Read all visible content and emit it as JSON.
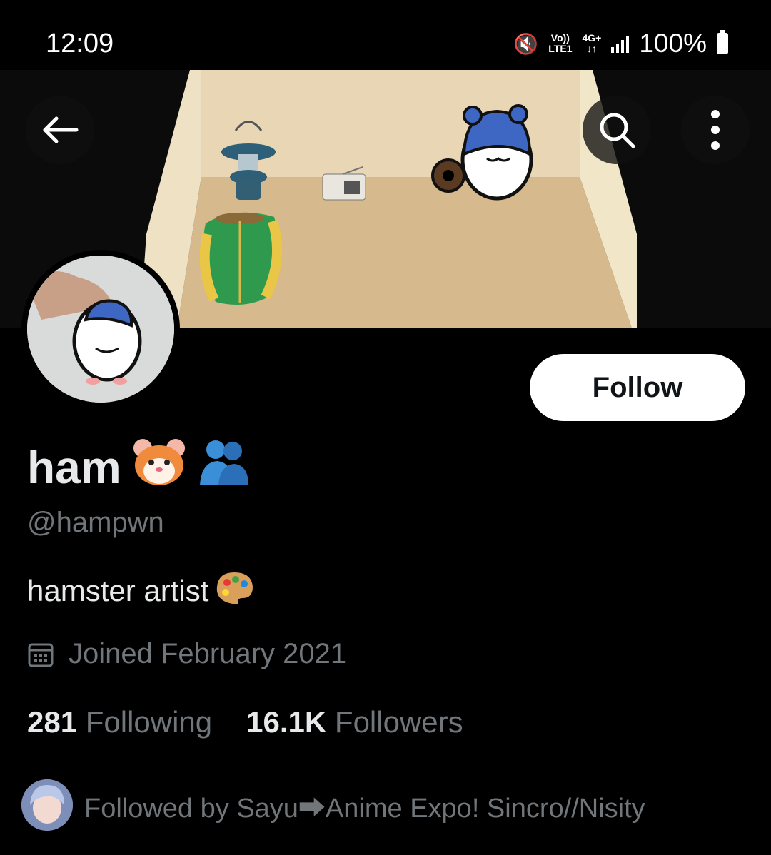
{
  "status_bar": {
    "time": "12:09",
    "volte_line1": "Vo))",
    "volte_line2": "LTE1",
    "net_line1": "4G+",
    "net_line2": "↓↑",
    "battery_text": "100%"
  },
  "header": {
    "back_icon": "arrow-left-icon",
    "search_icon": "search-icon",
    "more_icon": "more-vertical-icon"
  },
  "profile": {
    "display_name": "ham",
    "handle": "@hampwn",
    "bio": "hamster artist",
    "joined": "Joined February 2021",
    "following_count": "281",
    "following_label": "Following",
    "followers_count": "16.1K",
    "followers_label": "Followers",
    "followed_by": "Followed by Sayu⮕Anime Expo! Sincro//Nisity"
  },
  "actions": {
    "follow_label": "Follow"
  },
  "colors": {
    "background": "#000000",
    "text_primary": "#e7e9ea",
    "text_secondary": "#71767b",
    "follow_bg": "#ffffff"
  }
}
